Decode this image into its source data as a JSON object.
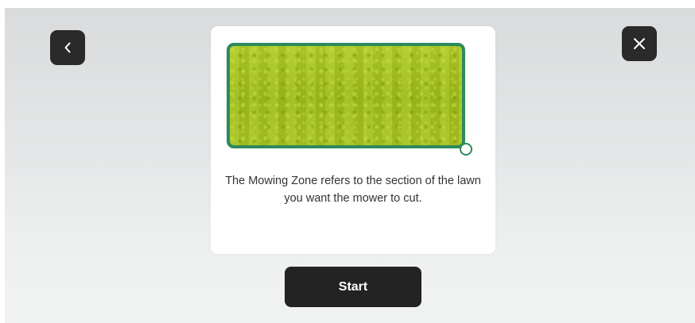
{
  "toolbar": {
    "back_icon": "chevron-left-icon",
    "close_icon": "close-icon"
  },
  "card": {
    "illustration": "mowing-zone-lawn",
    "description": "The Mowing Zone refers to the section of the lawn you want the mower to cut."
  },
  "actions": {
    "start_label": "Start"
  },
  "colors": {
    "button_dark": "#2a2a2a",
    "zone_border": "#2d8a5c",
    "lawn_green": "#a6c31f",
    "card_bg": "#ffffff",
    "text": "#333333"
  }
}
